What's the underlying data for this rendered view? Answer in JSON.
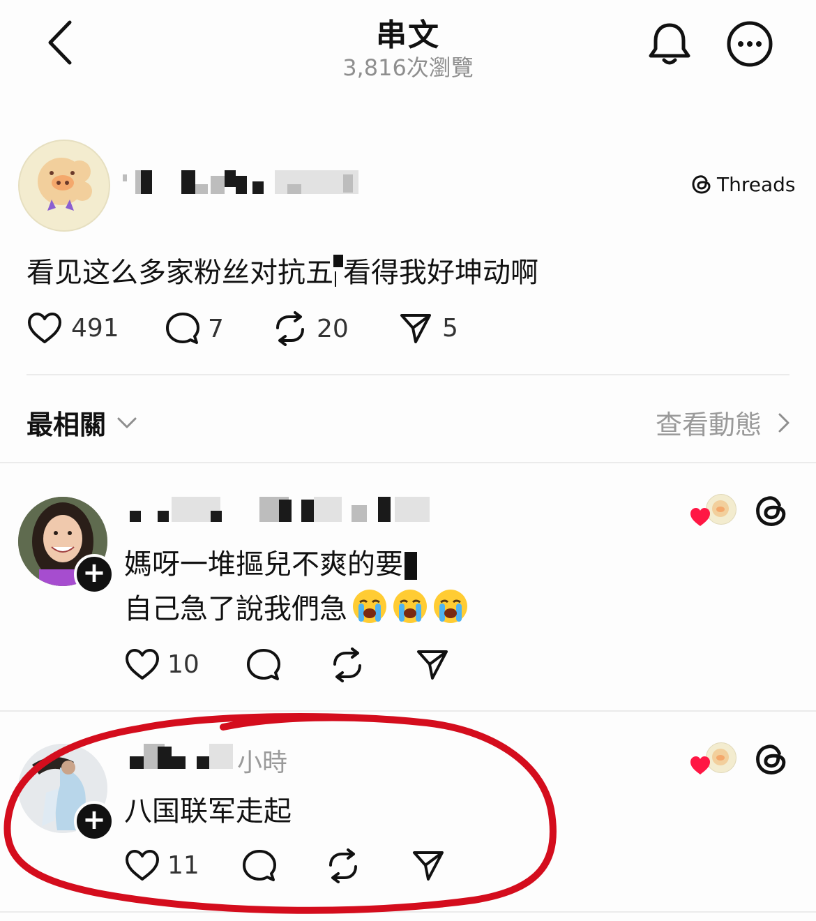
{
  "header": {
    "title": "串文",
    "views": "3,816次瀏覽"
  },
  "post": {
    "brand": "Threads",
    "text": "看见这么多家粉丝对抗五",
    "text_tail": "看得我好坤动啊",
    "likes": "491",
    "comments": "7",
    "reposts": "20",
    "shares": "5"
  },
  "filter": {
    "sort_label": "最相關",
    "activity_link": "查看動態"
  },
  "replies": [
    {
      "line1": "媽呀一堆摳兒不爽的要",
      "line2": "自己急了說我們急",
      "likes": "10"
    },
    {
      "time": "小時",
      "text": "八国联军走起",
      "likes": "11"
    }
  ],
  "colors": {
    "annotation": "#d40d1d",
    "heart": "#ff1744",
    "muted": "#8e8e8e"
  }
}
